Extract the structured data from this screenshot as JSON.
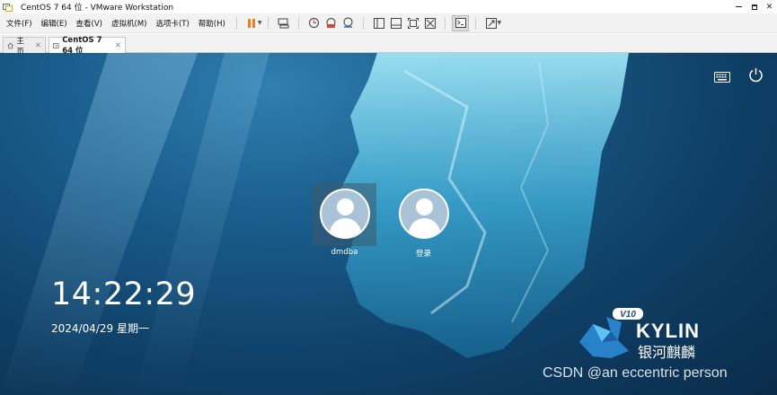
{
  "window": {
    "title": "CentOS 7 64 位 - VMware Workstation",
    "controls": {
      "minimize": "‒",
      "maximize": "□",
      "close": "✕"
    }
  },
  "menu": [
    {
      "label": "文件(F)"
    },
    {
      "label": "编辑(E)"
    },
    {
      "label": "查看(V)"
    },
    {
      "label": "虚拟机(M)"
    },
    {
      "label": "选项卡(T)"
    },
    {
      "label": "帮助(H)"
    }
  ],
  "toolbar": {
    "icons": [
      "pause-icon",
      "send-keys-icon",
      "snapshot-icon",
      "revert-snapshot-icon",
      "snapshot-manager-icon",
      "sidebar-icon",
      "thumbnail-bar-icon",
      "fullscreen-icon",
      "unity-icon",
      "console-icon",
      "stretch-icon"
    ]
  },
  "tabs": [
    {
      "label": "主页",
      "close": "✕",
      "active": false
    },
    {
      "label": "CentOS 7 64 位",
      "close": "✕",
      "active": true
    }
  ],
  "login": {
    "users": [
      {
        "name": "dmdba",
        "selected": true
      },
      {
        "name": "登录",
        "selected": false
      }
    ],
    "time": "14:22:29",
    "date": "2024/04/29 星期一",
    "logo": {
      "version": "V10",
      "brand": "KYLIN",
      "brand_cn": "银河麒麟"
    }
  },
  "watermark": "CSDN @an eccentric person",
  "colors": {
    "accent_pause": "#f07e1e",
    "bg_dark": "#0a2c4a",
    "bg_light": "#2f7fb0"
  }
}
